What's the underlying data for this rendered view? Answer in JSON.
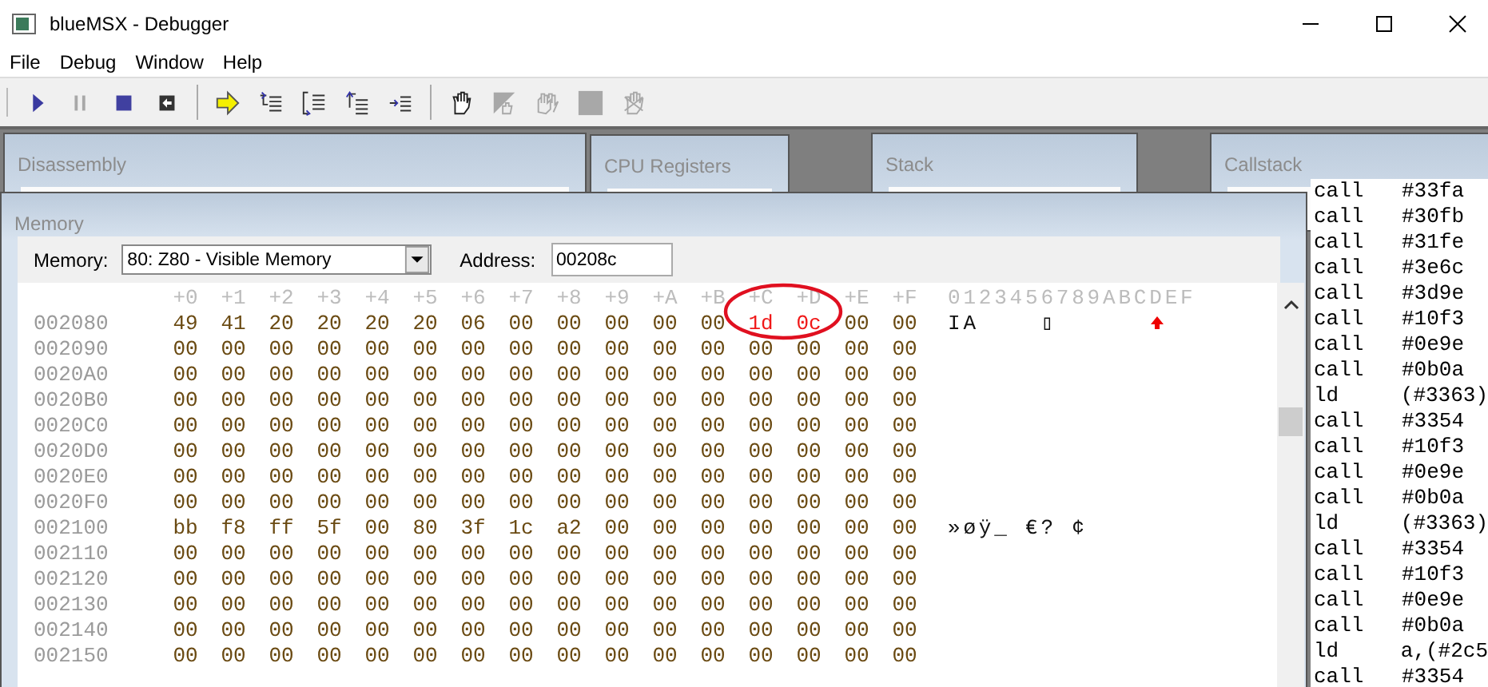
{
  "window": {
    "title": "blueMSX - Debugger"
  },
  "menu": [
    "File",
    "Debug",
    "Window",
    "Help"
  ],
  "toolbar": [
    {
      "kind": "play",
      "disabled": false
    },
    {
      "kind": "pause",
      "disabled": true
    },
    {
      "kind": "stop",
      "disabled": false
    },
    {
      "kind": "reset",
      "disabled": false
    },
    {
      "kind": "separator"
    },
    {
      "kind": "arrow",
      "disabled": false
    },
    {
      "kind": "step-into",
      "disabled": false
    },
    {
      "kind": "step-over",
      "disabled": false
    },
    {
      "kind": "step-out",
      "disabled": false
    },
    {
      "kind": "run-to",
      "disabled": false
    },
    {
      "kind": "separator"
    },
    {
      "kind": "hand",
      "disabled": false
    },
    {
      "kind": "hand-page",
      "disabled": true
    },
    {
      "kind": "hands",
      "disabled": true
    },
    {
      "kind": "square",
      "disabled": true
    },
    {
      "kind": "hand-cross",
      "disabled": true
    }
  ],
  "panels": [
    {
      "title": "Disassembly"
    },
    {
      "title": "CPU Registers"
    },
    {
      "title": "Stack"
    },
    {
      "title": "Callstack"
    }
  ],
  "callstack": [
    {
      "instruction": "call",
      "operand": "#33fa"
    },
    {
      "instruction": "call",
      "operand": "#30fb"
    },
    {
      "instruction": "call",
      "operand": "#31fe"
    },
    {
      "instruction": "call",
      "operand": "#3e6c"
    },
    {
      "instruction": "call",
      "operand": "#3d9e"
    },
    {
      "instruction": "call",
      "operand": "#10f3"
    },
    {
      "instruction": "call",
      "operand": "#0e9e"
    },
    {
      "instruction": "call",
      "operand": "#0b0a"
    },
    {
      "instruction": "ld",
      "operand": "(#3363)"
    },
    {
      "instruction": "call",
      "operand": "#3354"
    },
    {
      "instruction": "call",
      "operand": "#10f3"
    },
    {
      "instruction": "call",
      "operand": "#0e9e"
    },
    {
      "instruction": "call",
      "operand": "#0b0a"
    },
    {
      "instruction": "ld",
      "operand": "(#3363)"
    },
    {
      "instruction": "call",
      "operand": "#3354"
    },
    {
      "instruction": "call",
      "operand": "#10f3"
    },
    {
      "instruction": "call",
      "operand": "#0e9e"
    },
    {
      "instruction": "call",
      "operand": "#0b0a"
    },
    {
      "instruction": "ld",
      "operand": "a,(#2c5"
    },
    {
      "instruction": "call",
      "operand": "#3354"
    }
  ],
  "memory": {
    "title": "Memory",
    "memory_label": "Memory:",
    "memory_select": "80: Z80 - Visible Memory",
    "address_label": "Address:",
    "address": "00208c",
    "columns": [
      "+0",
      "+1",
      "+2",
      "+3",
      "+4",
      "+5",
      "+6",
      "+7",
      "+8",
      "+9",
      "+A",
      "+B",
      "+C",
      "+D",
      "+E",
      "+F"
    ],
    "ascii_header": "0123456789ABCDEF",
    "rows": [
      {
        "address": "002080",
        "bytes": [
          "49",
          "41",
          "20",
          "20",
          "20",
          "20",
          "06",
          "00",
          "00",
          "00",
          "00",
          "00",
          "1d",
          "0c",
          "00",
          "00"
        ],
        "changed": [
          false,
          false,
          false,
          false,
          false,
          false,
          false,
          false,
          false,
          false,
          false,
          false,
          true,
          true,
          false,
          false
        ],
        "ascii": "IA    ▯"
      },
      {
        "address": "002090",
        "bytes": [
          "00",
          "00",
          "00",
          "00",
          "00",
          "00",
          "00",
          "00",
          "00",
          "00",
          "00",
          "00",
          "00",
          "00",
          "00",
          "00"
        ]
      },
      {
        "address": "0020A0",
        "bytes": [
          "00",
          "00",
          "00",
          "00",
          "00",
          "00",
          "00",
          "00",
          "00",
          "00",
          "00",
          "00",
          "00",
          "00",
          "00",
          "00"
        ]
      },
      {
        "address": "0020B0",
        "bytes": [
          "00",
          "00",
          "00",
          "00",
          "00",
          "00",
          "00",
          "00",
          "00",
          "00",
          "00",
          "00",
          "00",
          "00",
          "00",
          "00"
        ]
      },
      {
        "address": "0020C0",
        "bytes": [
          "00",
          "00",
          "00",
          "00",
          "00",
          "00",
          "00",
          "00",
          "00",
          "00",
          "00",
          "00",
          "00",
          "00",
          "00",
          "00"
        ]
      },
      {
        "address": "0020D0",
        "bytes": [
          "00",
          "00",
          "00",
          "00",
          "00",
          "00",
          "00",
          "00",
          "00",
          "00",
          "00",
          "00",
          "00",
          "00",
          "00",
          "00"
        ]
      },
      {
        "address": "0020E0",
        "bytes": [
          "00",
          "00",
          "00",
          "00",
          "00",
          "00",
          "00",
          "00",
          "00",
          "00",
          "00",
          "00",
          "00",
          "00",
          "00",
          "00"
        ]
      },
      {
        "address": "0020F0",
        "bytes": [
          "00",
          "00",
          "00",
          "00",
          "00",
          "00",
          "00",
          "00",
          "00",
          "00",
          "00",
          "00",
          "00",
          "00",
          "00",
          "00"
        ]
      },
      {
        "address": "002100",
        "bytes": [
          "bb",
          "f8",
          "ff",
          "5f",
          "00",
          "80",
          "3f",
          "1c",
          "a2",
          "00",
          "00",
          "00",
          "00",
          "00",
          "00",
          "00"
        ],
        "ascii": "»øÿ_ €? ¢"
      },
      {
        "address": "002110",
        "bytes": [
          "00",
          "00",
          "00",
          "00",
          "00",
          "00",
          "00",
          "00",
          "00",
          "00",
          "00",
          "00",
          "00",
          "00",
          "00",
          "00"
        ]
      },
      {
        "address": "002120",
        "bytes": [
          "00",
          "00",
          "00",
          "00",
          "00",
          "00",
          "00",
          "00",
          "00",
          "00",
          "00",
          "00",
          "00",
          "00",
          "00",
          "00"
        ]
      },
      {
        "address": "002130",
        "bytes": [
          "00",
          "00",
          "00",
          "00",
          "00",
          "00",
          "00",
          "00",
          "00",
          "00",
          "00",
          "00",
          "00",
          "00",
          "00",
          "00"
        ]
      },
      {
        "address": "002140",
        "bytes": [
          "00",
          "00",
          "00",
          "00",
          "00",
          "00",
          "00",
          "00",
          "00",
          "00",
          "00",
          "00",
          "00",
          "00",
          "00",
          "00"
        ]
      },
      {
        "address": "002150",
        "bytes": [
          "00",
          "00",
          "00",
          "00",
          "00",
          "00",
          "00",
          "00",
          "00",
          "00",
          "00",
          "00",
          "00",
          "00",
          "00",
          "00"
        ]
      }
    ]
  }
}
